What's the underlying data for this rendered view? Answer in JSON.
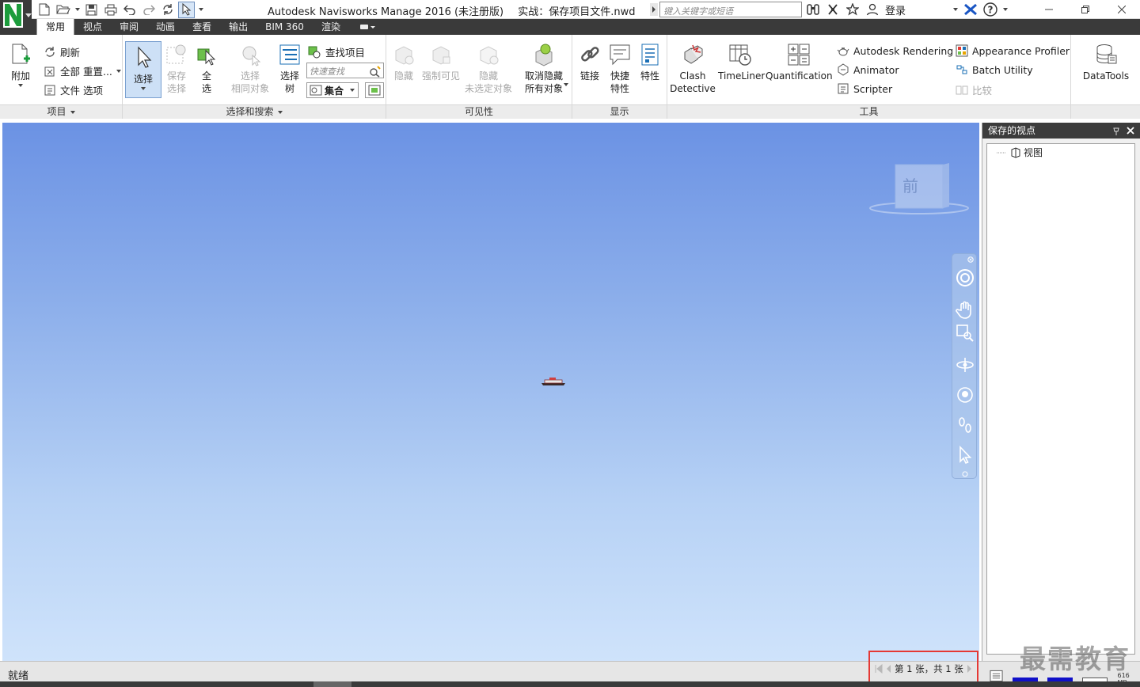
{
  "titlebar": {
    "app_title": "Autodesk Navisworks Manage 2016 (未注册版)",
    "doc_title": "实战：保存项目文件.nwd",
    "search_placeholder": "键入关键字或短语",
    "login_label": "登录",
    "help_label": "?"
  },
  "tabs": [
    "常用",
    "视点",
    "审阅",
    "动画",
    "查看",
    "输出",
    "BIM 360",
    "渲染"
  ],
  "ribbon": {
    "project": {
      "label": "项目",
      "append": "附加",
      "refresh": "刷新",
      "reset_all": "全部 重置...",
      "file_options": "文件 选项"
    },
    "select_search": {
      "label": "选择和搜索",
      "select": "选择",
      "save_selection": [
        "保存",
        "选择"
      ],
      "select_all": [
        "全",
        "选"
      ],
      "select_same": [
        "选择",
        "相同对象"
      ],
      "selection_tree": [
        "选择",
        "树"
      ],
      "find_items": "查找项目",
      "quick_find_placeholder": "快速查找",
      "sets": "集合"
    },
    "visibility": {
      "label": "可见性",
      "hide": "隐藏",
      "require": "强制可见",
      "hide_unselected": [
        "隐藏",
        "未选定对象"
      ],
      "unhide_all": [
        "取消隐藏",
        "所有对象"
      ]
    },
    "display": {
      "label": "显示",
      "links": "链接",
      "quick_props": [
        "快捷",
        "特性"
      ],
      "properties": "特性"
    },
    "tools": {
      "label": "工具",
      "clash": [
        "Clash",
        "Detective"
      ],
      "timeliner": "TimeLiner",
      "quantification": "Quantification",
      "autodesk_rendering": "Autodesk Rendering",
      "animator": "Animator",
      "scripter": "Scripter",
      "appearance_profiler": "Appearance Profiler",
      "batch_utility": "Batch Utility",
      "compare": "比较",
      "datatools": "DataTools"
    }
  },
  "viewcube": {
    "face_label": "前"
  },
  "saved_viewpoints": {
    "title": "保存的视点",
    "tree_item": "视图"
  },
  "statusbar": {
    "status": "就绪",
    "sheet_info": "第 1 张，共 1 张",
    "memory": "616 MB"
  },
  "watermark": "最需教育",
  "colors": {
    "tab_bar": "#3a3a3a",
    "viewport_top": "#6b92e4",
    "viewport_bottom": "#cfe3fb",
    "highlight": "#e53935"
  }
}
